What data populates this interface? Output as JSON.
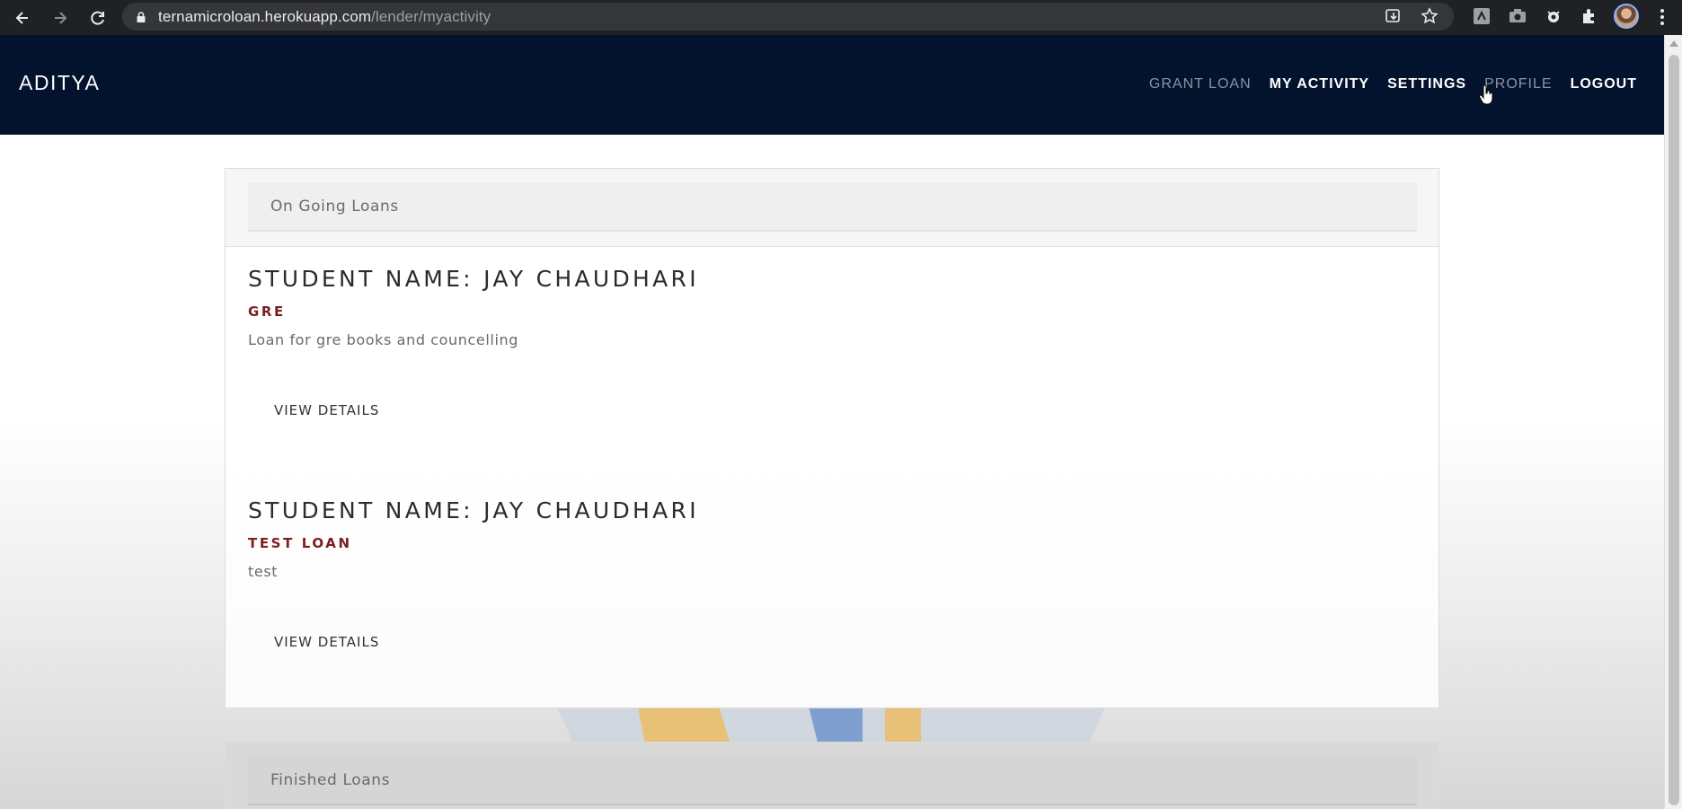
{
  "browser": {
    "url_host": "ternamicroloan.herokuapp.com",
    "url_path": "/lender/myactivity"
  },
  "navbar": {
    "brand": "ADITYA",
    "links": [
      {
        "label": "GRANT LOAN"
      },
      {
        "label": "MY ACTIVITY"
      },
      {
        "label": "SETTINGS"
      },
      {
        "label": "PROFILE"
      },
      {
        "label": "LOGOUT"
      }
    ]
  },
  "ongoing": {
    "heading": "On Going Loans",
    "loans": [
      {
        "title": "STUDENT NAME: JAY CHAUDHARI",
        "loan_name": "GRE",
        "description": "Loan for gre books and councelling",
        "button": "VIEW DETAILS"
      },
      {
        "title": "STUDENT NAME: JAY CHAUDHARI",
        "loan_name": "TEST LOAN",
        "description": "test",
        "button": "VIEW DETAILS"
      }
    ]
  },
  "finished": {
    "heading": "Finished Loans"
  },
  "colors": {
    "navbar_bg": "#03132e",
    "loan_name": "#7a1f1f",
    "chrome_bg": "#202124"
  }
}
